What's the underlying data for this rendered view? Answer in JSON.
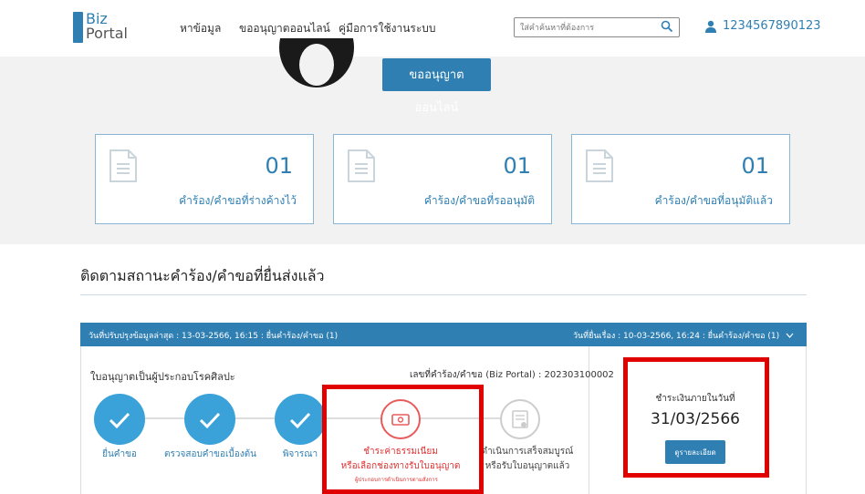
{
  "header": {
    "logo_top": "Biz",
    "logo_bottom": "Portal",
    "menu": [
      "หาข้อมูล",
      "ขออนุญาตออนไลน์",
      "คู่มือการใช้งานระบบ"
    ],
    "search_placeholder": "ใส่คำค้นหาที่ต้องการ",
    "user_id": "1234567890123"
  },
  "hero": {
    "online_button": "ขออนุญาตออนไลน์"
  },
  "summary_cards": [
    {
      "count": "01",
      "label": "คำร้อง/คำขอที่ร่างค้างไว้"
    },
    {
      "count": "01",
      "label": "คำร้อง/คำขอที่รออนุมัติ"
    },
    {
      "count": "01",
      "label": "คำร้อง/คำขอที่อนุมัติแล้ว"
    }
  ],
  "tracking": {
    "section_title": "ติดตามสถานะคำร้อง/คำขอที่ยื่นส่งแล้ว",
    "updated_text": "วันที่ปรับปรุงข้อมูลล่าสุด : 13-03-2566, 16:15 : ยื่นคำร้อง/คำขอ (1)",
    "submitted_text": "วันที่ยื่นเรื่อง : 10-03-2566, 16:24 : ยื่นคำร้อง/คำขอ (1)",
    "license_name": "ใบอนุญาตเป็นผู้ประกอบโรคศิลปะ",
    "request_no": "เลขที่คำร้อง/คำขอ (Biz Portal) : 202303100002",
    "steps": [
      {
        "label": "ยื่นคำขอ",
        "status": "done"
      },
      {
        "label": "ตรวจสอบคำขอเบื้องต้น",
        "status": "done"
      },
      {
        "label": "พิจารณา",
        "status": "done"
      },
      {
        "label": "ชำระค่าธรรมเนียม",
        "label2": "หรือเลือกช่องทางรับใบอนุญาต",
        "sub": "ผู้ประกอบการดำเนินการตามสั่งการ",
        "status": "current"
      },
      {
        "label": "ดำเนินการเสร็จสมบูรณ์",
        "label2": "หรือรับใบอนุญาตแล้ว",
        "status": "pending"
      }
    ],
    "payment": {
      "label": "ชำระเงินภายในวันที่",
      "due_date": "31/03/2566",
      "details_button": "ดูรายละเอียด"
    }
  },
  "colors": {
    "primary": "#2f7fb3",
    "step_done": "#3ba2d9",
    "highlight": "#e00000"
  }
}
